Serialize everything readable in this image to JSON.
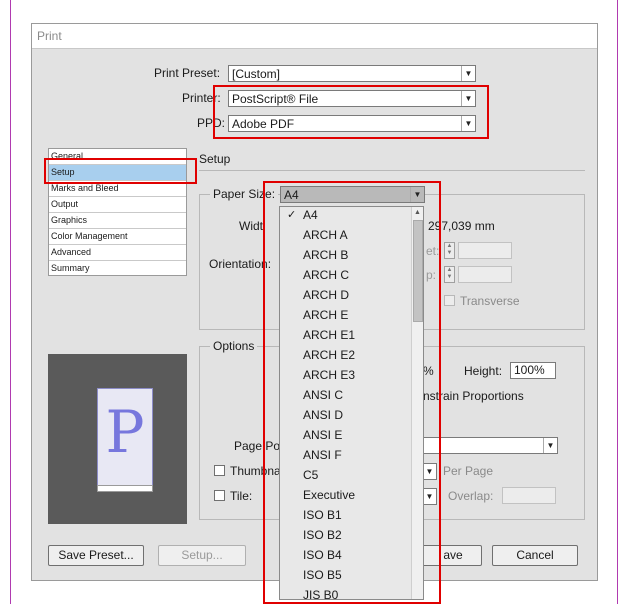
{
  "window": {
    "title": "Print"
  },
  "print_preset": {
    "label": "Print Preset:",
    "value": "[Custom]"
  },
  "printer": {
    "label": "Printer:",
    "value": "PostScript® File"
  },
  "ppd": {
    "label": "PPD:",
    "value": "Adobe PDF"
  },
  "sidebar": {
    "items": [
      {
        "label": "General"
      },
      {
        "label": "Setup"
      },
      {
        "label": "Marks and Bleed"
      },
      {
        "label": "Output"
      },
      {
        "label": "Graphics"
      },
      {
        "label": "Color Management"
      },
      {
        "label": "Advanced"
      },
      {
        "label": "Summary"
      }
    ],
    "selected": "Setup"
  },
  "section": {
    "title": "Setup"
  },
  "paper": {
    "size_label": "Paper Size:",
    "size_value": "A4",
    "width_label": "Widt",
    "height_value": "297,039 mm",
    "offset_label": "et:",
    "gap_label": "p:",
    "orientation_label": "Orientation:",
    "transverse_label": "Transverse"
  },
  "options": {
    "title": "Options",
    "height_label": "Height:",
    "height_value": "100%",
    "scale_fragment": "%",
    "constrain_label": "nstrain Proportions",
    "page_position_label": "Page Po",
    "thumbnails_label": "Thumbna",
    "per_page_label": "Per Page",
    "tile_label": "Tile:",
    "overlap_label": "Overlap:"
  },
  "preview": {
    "glyph": "P"
  },
  "paper_size_list": {
    "selected": "A4",
    "check_glyph": "✓",
    "items": [
      "A4",
      "ARCH A",
      "ARCH B",
      "ARCH C",
      "ARCH D",
      "ARCH E",
      "ARCH E1",
      "ARCH E2",
      "ARCH E3",
      "ANSI C",
      "ANSI D",
      "ANSI E",
      "ANSI F",
      "C5",
      "Executive",
      "ISO B1",
      "ISO B2",
      "ISO B4",
      "ISO B5",
      "JIS B0"
    ]
  },
  "buttons": {
    "save_preset": "Save Preset...",
    "setup": "Setup...",
    "save": "ave",
    "cancel": "Cancel"
  },
  "colors": {
    "highlight_box": "#e00000",
    "selection": "#a8cfee",
    "preview_glyph": "#7777dd"
  }
}
